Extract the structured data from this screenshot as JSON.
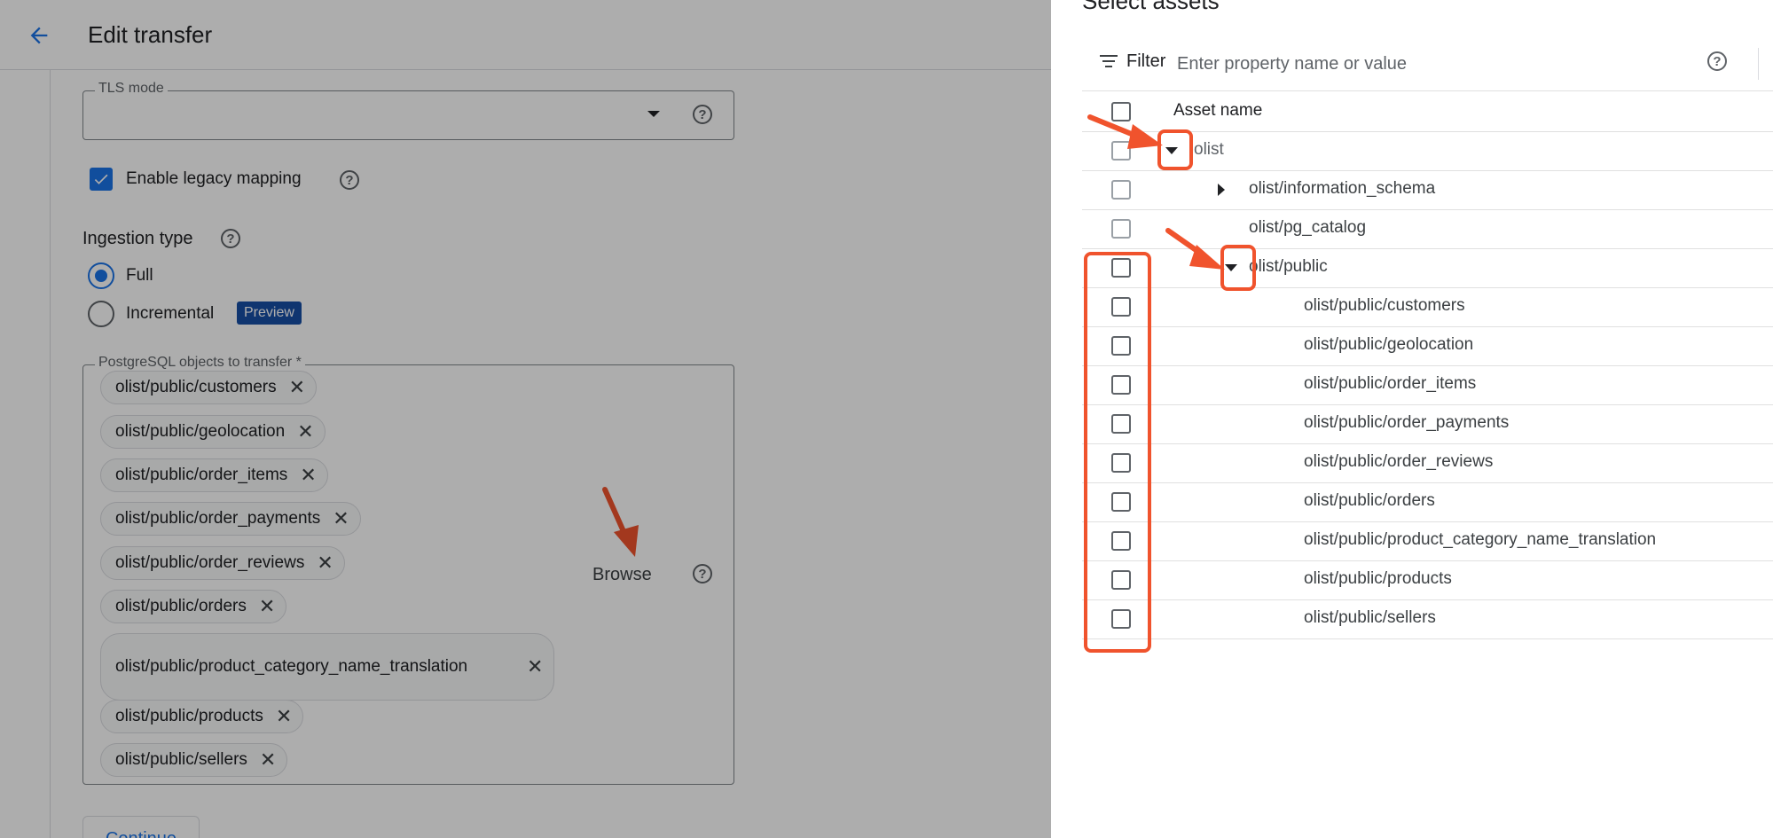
{
  "left": {
    "title": "Edit transfer",
    "tls_mode": {
      "label": "TLS mode",
      "value": ""
    },
    "legacy_mapping": {
      "label": "Enable legacy mapping",
      "checked": true
    },
    "ingestion": {
      "label": "Ingestion type",
      "options": [
        {
          "label": "Full",
          "selected": true
        },
        {
          "label": "Incremental",
          "selected": false,
          "badge": "Preview"
        }
      ]
    },
    "objects": {
      "label": "PostgreSQL objects to transfer *",
      "chips": [
        "olist/public/customers",
        "olist/public/geolocation",
        "olist/public/order_items",
        "olist/public/order_payments",
        "olist/public/order_reviews",
        "olist/public/orders",
        "olist/public/product_category_name_translation",
        "olist/public/products",
        "olist/public/sellers"
      ],
      "chip_remove_glyph": "✕"
    },
    "browse_label": "Browse",
    "continue_label": "Continue"
  },
  "right": {
    "title": "Select assets",
    "filter": {
      "label": "Filter",
      "placeholder": "Enter property name or value"
    },
    "column_header": "Asset name",
    "rows": [
      {
        "name": "olist",
        "expander": "down"
      },
      {
        "name": "olist/information_schema",
        "expander": "right"
      },
      {
        "name": "olist/pg_catalog",
        "expander": "none"
      },
      {
        "name": "olist/public",
        "expander": "down"
      },
      {
        "name": "olist/public/customers",
        "expander": "none"
      },
      {
        "name": "olist/public/geolocation",
        "expander": "none"
      },
      {
        "name": "olist/public/order_items",
        "expander": "none"
      },
      {
        "name": "olist/public/order_payments",
        "expander": "none"
      },
      {
        "name": "olist/public/order_reviews",
        "expander": "none"
      },
      {
        "name": "olist/public/orders",
        "expander": "none"
      },
      {
        "name": "olist/public/product_category_name_translation",
        "expander": "none"
      },
      {
        "name": "olist/public/products",
        "expander": "none"
      },
      {
        "name": "olist/public/sellers",
        "expander": "none"
      }
    ]
  },
  "colors": {
    "accent": "#1a73e8",
    "annotation": "#f0532d",
    "scrim": "rgba(0,0,0,0.32)"
  },
  "icons": [
    "back-arrow-icon",
    "dropdown-arrow-icon",
    "help-icon",
    "check-icon",
    "close-icon",
    "filter-icon",
    "columns-icon",
    "expand-more-icon",
    "chevron-right-icon"
  ]
}
